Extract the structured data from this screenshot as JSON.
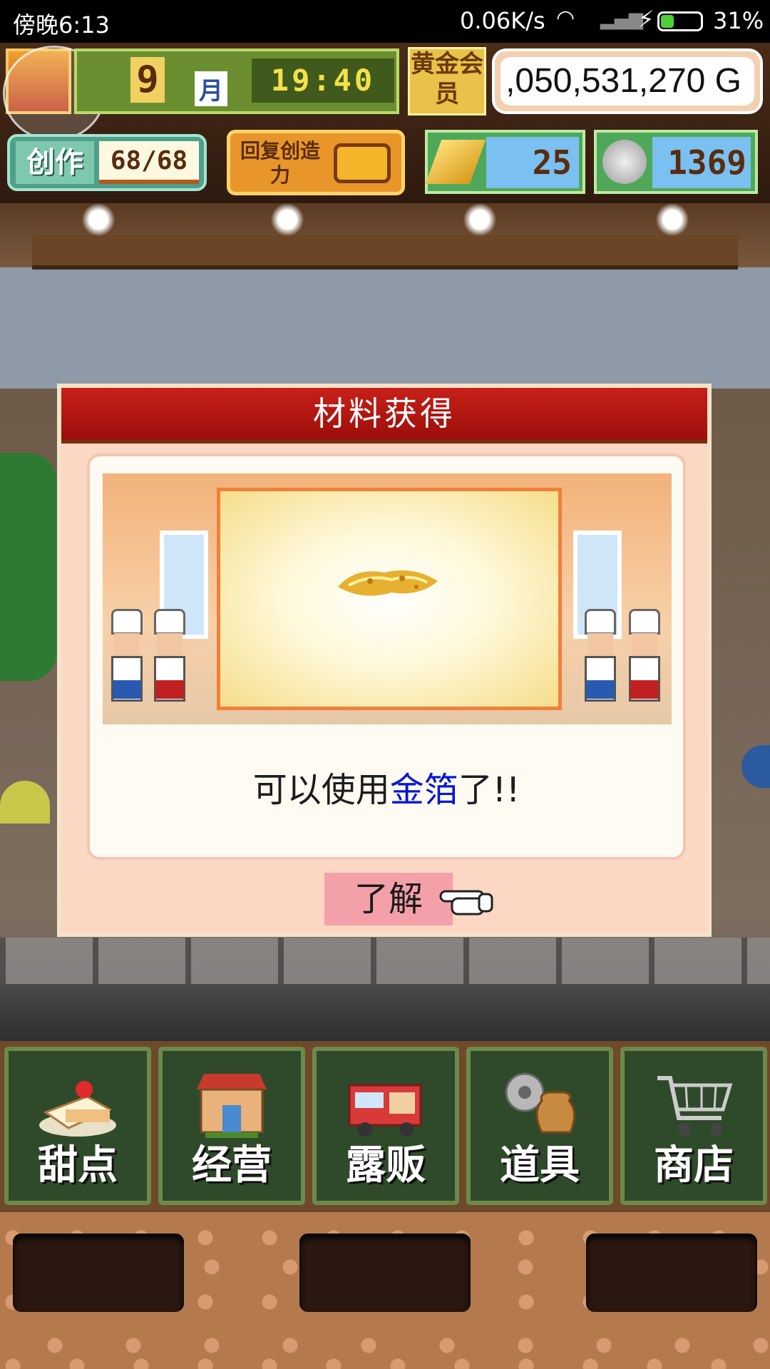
{
  "status_bar": {
    "time": "傍晚6:13",
    "net_speed": "0.06K/s",
    "battery": "31%"
  },
  "hud": {
    "month_number": "9",
    "month_label": "月",
    "clock": "19:40",
    "gold_member_label": "黄金会员",
    "money": ",050,531,270 G",
    "create_label": "创作",
    "create_value": "68/68",
    "recover_label": "回复创造力",
    "gold_bars": "25",
    "medals": "1369"
  },
  "modal": {
    "title": "材料获得",
    "message_prefix": "可以使用",
    "message_highlight": "金箔",
    "message_suffix": "了!!",
    "ok_button": "了解",
    "item_icon": "gold-leaf-icon"
  },
  "nav": {
    "items": [
      {
        "label": "甜点",
        "icon": "cake-icon"
      },
      {
        "label": "经营",
        "icon": "shop-icon"
      },
      {
        "label": "露贩",
        "icon": "food-truck-icon"
      },
      {
        "label": "道具",
        "icon": "items-bag-icon"
      },
      {
        "label": "商店",
        "icon": "cart-icon"
      }
    ]
  },
  "colors": {
    "modal_header": "#c8201a",
    "highlight_text": "#0018d8",
    "ok_button": "#f4a0a8"
  }
}
